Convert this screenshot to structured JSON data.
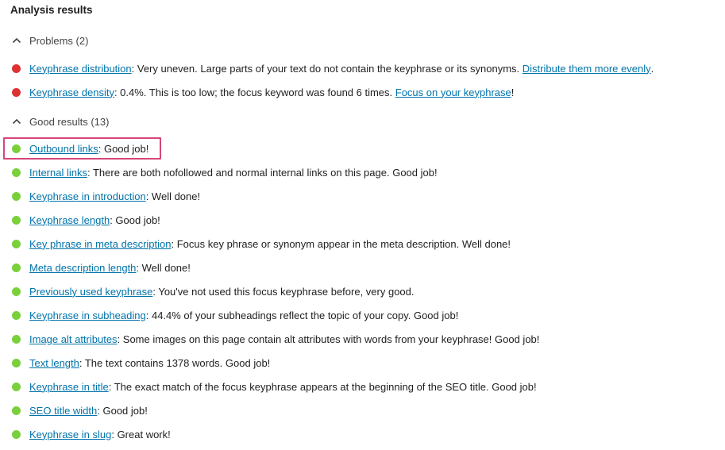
{
  "title": "Analysis results",
  "colors": {
    "problem": "#dc3232",
    "good": "#7ad03a",
    "link": "#0073aa",
    "highlight": "#d6457a"
  },
  "problems": {
    "label": "Problems (2)",
    "icon": "chevron-up-icon",
    "items": [
      {
        "link": "Keyphrase distribution",
        "text": ": Very uneven. Large parts of your text do not contain the keyphrase or its synonyms. ",
        "action": "Distribute them more evenly",
        "tail": "."
      },
      {
        "link": "Keyphrase density",
        "text": ": 0.4%. This is too low; the focus keyword was found 6 times. ",
        "action": "Focus on your keyphrase",
        "tail": "!"
      }
    ]
  },
  "good": {
    "label": "Good results (13)",
    "icon": "chevron-up-icon",
    "items": [
      {
        "link": "Outbound links",
        "text": ": Good job!",
        "highlighted": true
      },
      {
        "link": "Internal links",
        "text": ": There are both nofollowed and normal internal links on this page. Good job!"
      },
      {
        "link": "Keyphrase in introduction",
        "text": ": Well done!"
      },
      {
        "link": "Keyphrase length",
        "text": ": Good job!"
      },
      {
        "link": "Key phrase in meta description",
        "text": ": Focus key phrase or synonym appear in the meta description. Well done!"
      },
      {
        "link": "Meta description length",
        "text": ": Well done!"
      },
      {
        "link": "Previously used keyphrase",
        "text": ": You've not used this focus keyphrase before, very good."
      },
      {
        "link": "Keyphrase in subheading",
        "text": ": 44.4% of your subheadings reflect the topic of your copy. Good job!"
      },
      {
        "link": "Image alt attributes",
        "text": ": Some images on this page contain alt attributes with words from your keyphrase! Good job!"
      },
      {
        "link": "Text length",
        "text": ": The text contains 1378 words. Good job!"
      },
      {
        "link": "Keyphrase in title",
        "text": ": The exact match of the focus keyphrase appears at the beginning of the SEO title. Good job!"
      },
      {
        "link": "SEO title width",
        "text": ": Good job!"
      },
      {
        "link": "Keyphrase in slug",
        "text": ": Great work!"
      }
    ]
  }
}
